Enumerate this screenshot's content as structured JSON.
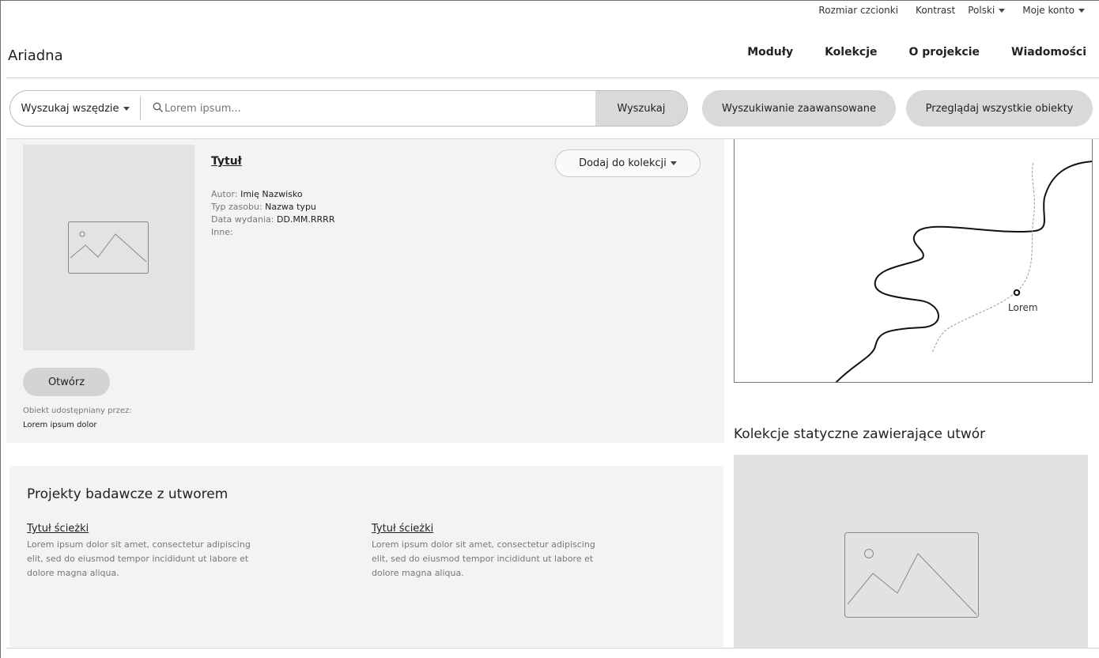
{
  "utility_nav": {
    "font_size": "Rozmiar czcionki",
    "contrast": "Kontrast",
    "language": "Polski",
    "account": "Moje konto"
  },
  "header": {
    "logo": "Ariadna",
    "nav": [
      "Moduły",
      "Kolekcje",
      "O projekcie",
      "Wiadomości"
    ]
  },
  "search": {
    "scope": "Wyszukaj wszędzie",
    "placeholder": "Lorem ipsum...",
    "button": "Wyszukaj",
    "advanced": "Wyszukiwanie zaawansowane",
    "browse_all": "Przeglądaj wszystkie obiekty"
  },
  "object": {
    "title": "Tytuł",
    "add_to_collection": "Dodaj do kolekcji",
    "meta": [
      {
        "label": "Autor:",
        "value": "Imię Nazwisko"
      },
      {
        "label": "Typ zasobu:",
        "value": "Nazwa typu"
      },
      {
        "label": "Data wydania:",
        "value": "DD.MM.RRRR"
      },
      {
        "label": "Inne:",
        "value": ""
      }
    ],
    "open_button": "Otwórz",
    "shared_by_label": "Obiekt udostępniany przez:",
    "shared_by_value": "Lorem ipsum dolor"
  },
  "map": {
    "place_label": "Lorem"
  },
  "collections": {
    "heading": "Kolekcje statyczne zawierające utwór"
  },
  "projects": {
    "heading": "Projekty badawcze z utworem",
    "items": [
      {
        "title": "Tytuł ścieżki",
        "description": "Lorem ipsum dolor sit amet, consectetur adipiscing elit, sed do eiusmod tempor incididunt ut labore et dolore magna aliqua."
      },
      {
        "title": "Tytuł ścieżki",
        "description": "Lorem ipsum dolor sit amet, consectetur adipiscing elit, sed do eiusmod tempor incididunt ut labore et dolore magna aliqua."
      }
    ]
  }
}
